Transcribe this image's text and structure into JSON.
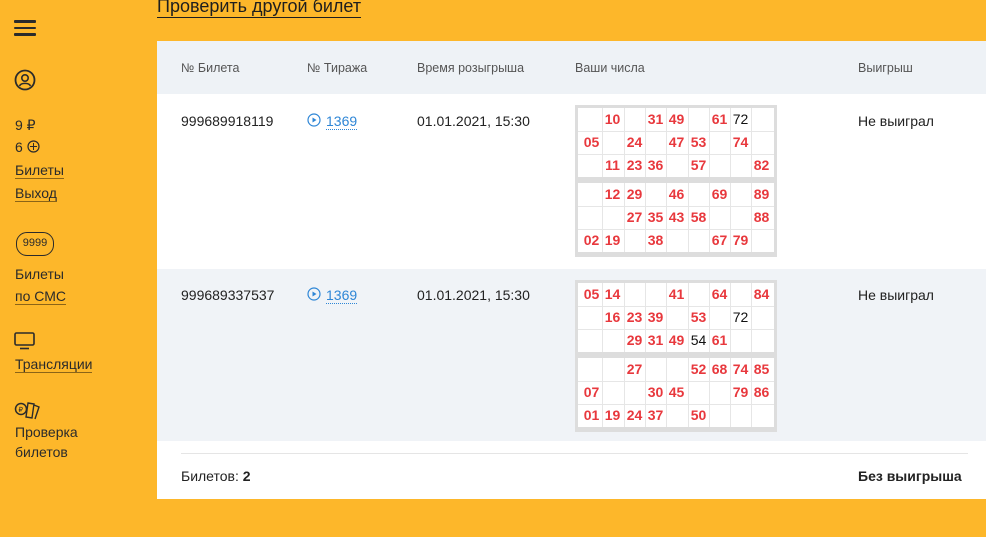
{
  "top_link": "Проверить другой билет",
  "sidebar": {
    "balance": "9 ₽",
    "bonus": "6",
    "tickets_link": "Билеты",
    "logout_link": "Выход",
    "sms_badge": "9999",
    "sms_line1": "Билеты",
    "sms_line2": "по СМС",
    "broadcasts": "Трансляции",
    "check_line1": "Проверка",
    "check_line2": "билетов"
  },
  "table": {
    "headers": [
      "№ Билета",
      "№ Тиража",
      "Время розыгрыша",
      "Ваши числа",
      "Выигрыш"
    ],
    "rows": [
      {
        "ticket": "999689918119",
        "draw": "1369",
        "time": "01.01.2021, 15:30",
        "result": "Не выиграл",
        "fields": [
          [
            [
              "",
              "10",
              "",
              "31",
              "49",
              "",
              "61",
              "72",
              ""
            ],
            [
              "05",
              "",
              "24",
              "",
              "47",
              "53",
              "",
              "74",
              ""
            ],
            [
              "",
              "11",
              "23",
              "36",
              "",
              "57",
              "",
              "",
              "82"
            ]
          ],
          [
            [
              "",
              "12",
              "29",
              "",
              "46",
              "",
              "69",
              "",
              "89"
            ],
            [
              "",
              "",
              "27",
              "35",
              "43",
              "58",
              "",
              "",
              "88"
            ],
            [
              "02",
              "19",
              "",
              "38",
              "",
              "",
              "67",
              "79",
              ""
            ]
          ]
        ],
        "unmatched": [
          "72"
        ]
      },
      {
        "ticket": "999689337537",
        "draw": "1369",
        "time": "01.01.2021, 15:30",
        "result": "Не выиграл",
        "fields": [
          [
            [
              "05",
              "14",
              "",
              "",
              "41",
              "",
              "64",
              "",
              "84"
            ],
            [
              "",
              "16",
              "23",
              "39",
              "",
              "53",
              "",
              "72",
              ""
            ],
            [
              "",
              "",
              "29",
              "31",
              "49",
              "54",
              "61",
              "",
              ""
            ]
          ],
          [
            [
              "",
              "",
              "27",
              "",
              "",
              "52",
              "68",
              "74",
              "85"
            ],
            [
              "07",
              "",
              "",
              "30",
              "45",
              "",
              "",
              "79",
              "86"
            ],
            [
              "01",
              "19",
              "24",
              "37",
              "",
              "50",
              "",
              "",
              ""
            ]
          ]
        ],
        "unmatched": [
          "72",
          "54"
        ]
      }
    ]
  },
  "footer": {
    "count_label": "Билетов: ",
    "count_value": "2",
    "summary": "Без выигрыша"
  },
  "colors": {
    "background": "#FDB72A",
    "matched_number": "#E8383D",
    "link": "#2E86D6"
  }
}
